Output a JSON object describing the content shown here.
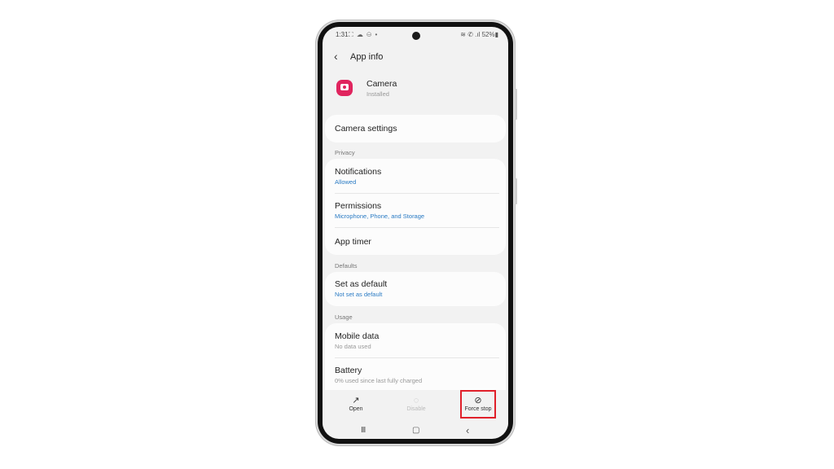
{
  "status_bar": {
    "time": "1:31",
    "notification_icons": "⛶ ☁ ⊖ •",
    "right_icons": "≋ ✆ .ıl",
    "battery": "52%"
  },
  "header": {
    "back_icon": "‹",
    "title": "App info"
  },
  "app": {
    "name": "Camera",
    "status": "Installed",
    "icon_color": "#e0245e"
  },
  "camera_settings": {
    "label": "Camera settings"
  },
  "sections": {
    "privacy": "Privacy",
    "defaults": "Defaults",
    "usage": "Usage"
  },
  "privacy_items": [
    {
      "title": "Notifications",
      "subtitle": "Allowed"
    },
    {
      "title": "Permissions",
      "subtitle": "Microphone, Phone, and Storage"
    },
    {
      "title": "App timer"
    }
  ],
  "defaults_items": [
    {
      "title": "Set as default",
      "subtitle": "Not set as default"
    }
  ],
  "usage_items": [
    {
      "title": "Mobile data",
      "subtitle": "No data used"
    },
    {
      "title": "Battery",
      "subtitle": "0% used since last fully charged"
    }
  ],
  "bottom_actions": {
    "open": {
      "label": "Open",
      "icon": "↗"
    },
    "disable": {
      "label": "Disable",
      "icon": "◌"
    },
    "force_stop": {
      "label": "Force stop",
      "icon": "⊘"
    }
  },
  "nav_bar": {
    "recents": "III",
    "home": "▢",
    "back": "‹"
  },
  "highlight_color": "#e0202a",
  "accent_blue": "#2a7bc4"
}
